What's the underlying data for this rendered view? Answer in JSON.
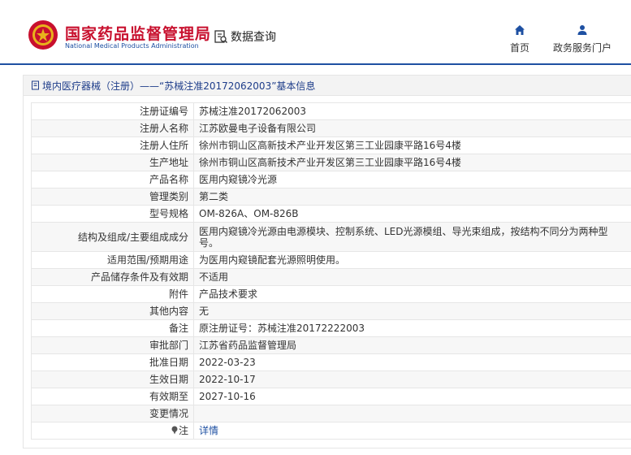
{
  "header": {
    "brand_cn": "国家药品监督管理局",
    "brand_en": "National Medical Products Administration",
    "query_label": "数据查询",
    "nav": {
      "home": "首页",
      "portal": "政务服务门户"
    }
  },
  "panel": {
    "breadcrumb": "境内医疗器械（注册）——“苏械注准20172062003”基本信息"
  },
  "rows": [
    {
      "label": "注册证编号",
      "value": "苏械注准20172062003"
    },
    {
      "label": "注册人名称",
      "value": "江苏欧曼电子设备有限公司"
    },
    {
      "label": "注册人住所",
      "value": "徐州市铜山区高新技术产业开发区第三工业园康平路16号4楼"
    },
    {
      "label": "生产地址",
      "value": "徐州市铜山区高新技术产业开发区第三工业园康平路16号4楼"
    },
    {
      "label": "产品名称",
      "value": "医用内窥镜冷光源"
    },
    {
      "label": "管理类别",
      "value": "第二类"
    },
    {
      "label": "型号规格",
      "value": "OM-826A、OM-826B"
    },
    {
      "label": "结构及组成/主要组成成分",
      "value": "医用内窥镜冷光源由电源模块、控制系统、LED光源模组、导光束组成，按结构不同分为两种型号。"
    },
    {
      "label": "适用范围/预期用途",
      "value": "为医用内窥镜配套光源照明使用。"
    },
    {
      "label": "产品储存条件及有效期",
      "value": "不适用"
    },
    {
      "label": "附件",
      "value": "产品技术要求"
    },
    {
      "label": "其他内容",
      "value": "无"
    },
    {
      "label": "备注",
      "value": "原注册证号：苏械注准20172222003"
    },
    {
      "label": "审批部门",
      "value": "江苏省药品监督管理局"
    },
    {
      "label": "批准日期",
      "value": "2022-03-23"
    },
    {
      "label": "生效日期",
      "value": "2022-10-17"
    },
    {
      "label": "有效期至",
      "value": "2027-10-16"
    },
    {
      "label": "变更情况",
      "value": ""
    },
    {
      "label": "注",
      "value": "详情"
    }
  ],
  "icons": {
    "logo": "national-emblem-icon",
    "query": "data-query-icon",
    "home": "home-icon",
    "portal": "user-icon",
    "breadcrumb": "document-icon",
    "note": "pin-icon"
  },
  "colors": {
    "brand_red": "#c8102e",
    "brand_blue": "#1e50a2"
  }
}
